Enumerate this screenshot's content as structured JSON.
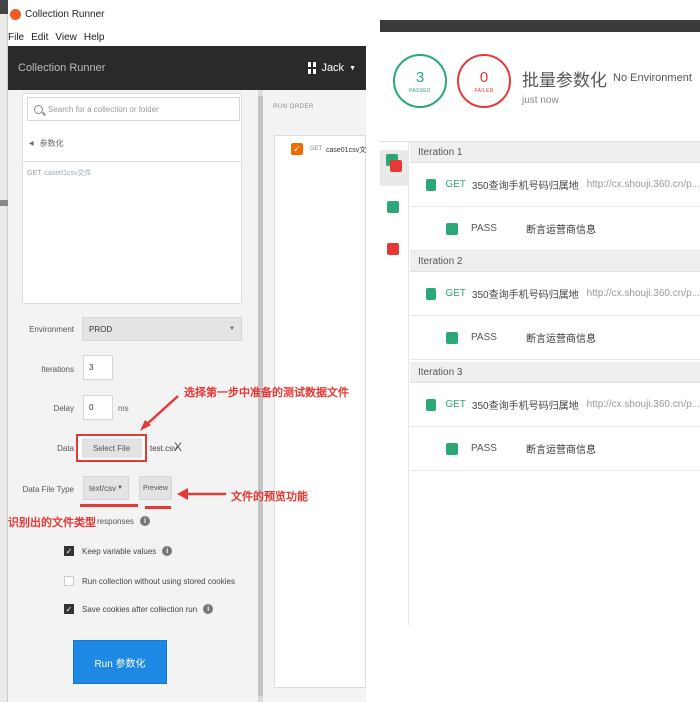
{
  "left_window": {
    "app_title": "Collection Runner",
    "menu": [
      "File",
      "Edit",
      "View",
      "Help"
    ],
    "header_title": "Collection Runner",
    "user_name": "Jack",
    "search_placeholder": "Search for a collection or folder",
    "breadcrumb": "参数化",
    "request_method": "GET",
    "request_name": "case01csv文件",
    "environment_label": "Environment",
    "environment_value": "PROD",
    "iterations_label": "Iterations",
    "iterations_value": "3",
    "delay_label": "Delay",
    "delay_value": "0",
    "delay_unit": "ms",
    "data_label": "Data",
    "select_file_label": "Select File",
    "file_name": "test.csv",
    "remove_file_symbol": "X",
    "data_file_type_label": "Data File Type",
    "data_file_type_value": "text/csv",
    "preview_label": "Preview",
    "responses_text": "responses",
    "options": [
      {
        "label": "Keep variable values",
        "checked": true,
        "info": true
      },
      {
        "label": "Run collection without using stored cookies",
        "checked": false,
        "info": false
      },
      {
        "label": "Save cookies after collection run",
        "checked": true,
        "info": true
      }
    ],
    "run_button": "Run 参数化",
    "run_order_heading": "RUN ORDER",
    "run_order_item_method": "GET",
    "run_order_item_name": "case01csv文件"
  },
  "annotations": {
    "select_file_note": "选择第一步中准备的测试数据文件",
    "preview_note": "文件的预览功能",
    "file_type_note": "识别出的文件类型"
  },
  "right_window": {
    "passed_count": "3",
    "passed_label": "PASSED",
    "failed_count": "0",
    "failed_label": "FAILED",
    "run_title": "批量参数化",
    "environment": "No Environment",
    "time": "just now",
    "iterations": [
      {
        "label": "Iteration 1",
        "method": "GET",
        "request_name": "350查询手机号码归属地",
        "url": "http://cx.shouji.360.cn/p...",
        "status": "PASS",
        "assertion": "断言运营商信息"
      },
      {
        "label": "Iteration 2",
        "method": "GET",
        "request_name": "350查询手机号码归属地",
        "url": "http://cx.shouji.360.cn/p...",
        "status": "PASS",
        "assertion": "断言运营商信息"
      },
      {
        "label": "Iteration 3",
        "method": "GET",
        "request_name": "350查询手机号码归属地",
        "url": "http://cx.shouji.360.cn/p...",
        "status": "PASS",
        "assertion": "断言运营商信息"
      }
    ]
  },
  "colors": {
    "pass_green": "#2aa876",
    "fail_red": "#e53935",
    "annotation_red": "#e53935",
    "run_button_blue": "#1e88e5",
    "header_dark": "#2a2a2a",
    "accent_orange": "#ef6c00"
  },
  "icons": [
    "search-icon",
    "chevron-left-icon",
    "grid-icon",
    "caret-down-icon",
    "info-icon",
    "check-icon",
    "close-icon",
    "arrow-icon"
  ]
}
